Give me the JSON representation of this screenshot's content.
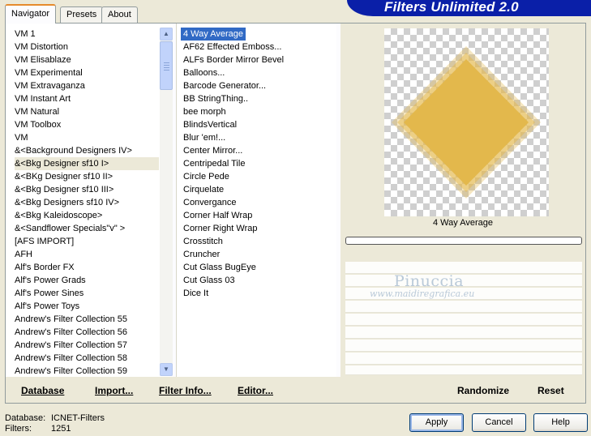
{
  "header": {
    "title": "Filters Unlimited 2.0"
  },
  "tabs": [
    "Navigator",
    "Presets",
    "About"
  ],
  "categories": [
    "VM 1",
    "VM Distortion",
    "VM Elisablaze",
    "VM Experimental",
    "VM Extravaganza",
    "VM Instant Art",
    "VM Natural",
    "VM Toolbox",
    "VM",
    "&<Background Designers IV>",
    "&<Bkg Designer sf10 I>",
    "&<BKg Designer sf10 II>",
    "&<Bkg Designer sf10 III>",
    "&<Bkg Designers sf10 IV>",
    "&<Bkg Kaleidoscope>",
    "&<Sandflower Specials\"v\" >",
    "[AFS IMPORT]",
    "AFH",
    "Alf's Border FX",
    "Alf's Power Grads",
    "Alf's Power Sines",
    "Alf's Power Toys",
    "Andrew's Filter Collection 55",
    "Andrew's Filter Collection 56",
    "Andrew's Filter Collection 57",
    "Andrew's Filter Collection 58",
    "Andrew's Filter Collection 59"
  ],
  "filters": [
    "4 Way Average",
    "AF62 Effected Emboss...",
    "ALFs Border Mirror Bevel",
    "Balloons...",
    "Barcode Generator...",
    "BB StringThing..",
    "bee morph",
    "BlindsVertical",
    "Blur 'em!...",
    "Center Mirror...",
    "Centripedal Tile",
    "Circle Pede",
    "Cirquelate",
    "Convergance",
    "Corner Half Wrap",
    "Corner Right Wrap",
    "Crosstitch",
    "Cruncher",
    "Cut Glass  BugEye",
    "Cut Glass 03",
    "Dice It"
  ],
  "bottom_bar": {
    "database": "Database",
    "import": "Import...",
    "filter_info": "Filter Info...",
    "editor": "Editor...",
    "randomize": "Randomize",
    "reset": "Reset"
  },
  "preview": {
    "filter_name": "4 Way Average",
    "progress": 0,
    "shape_color": "#e3b84c",
    "watermark_title": "Pinuccia",
    "watermark_url": "www.maidiregrafica.eu"
  },
  "footer": {
    "database_label": "Database:",
    "database_value": "ICNET-Filters",
    "filters_label": "Filters:",
    "filters_value": "1251",
    "apply": "Apply",
    "cancel": "Cancel",
    "help": "Help"
  }
}
